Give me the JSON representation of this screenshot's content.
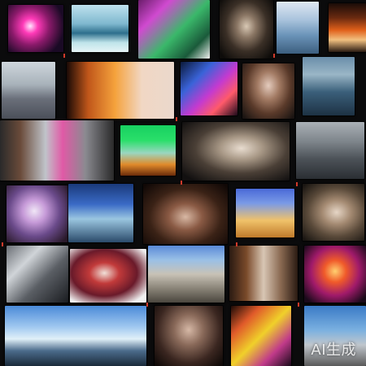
{
  "watermark": {
    "text": "AI生成"
  }
}
